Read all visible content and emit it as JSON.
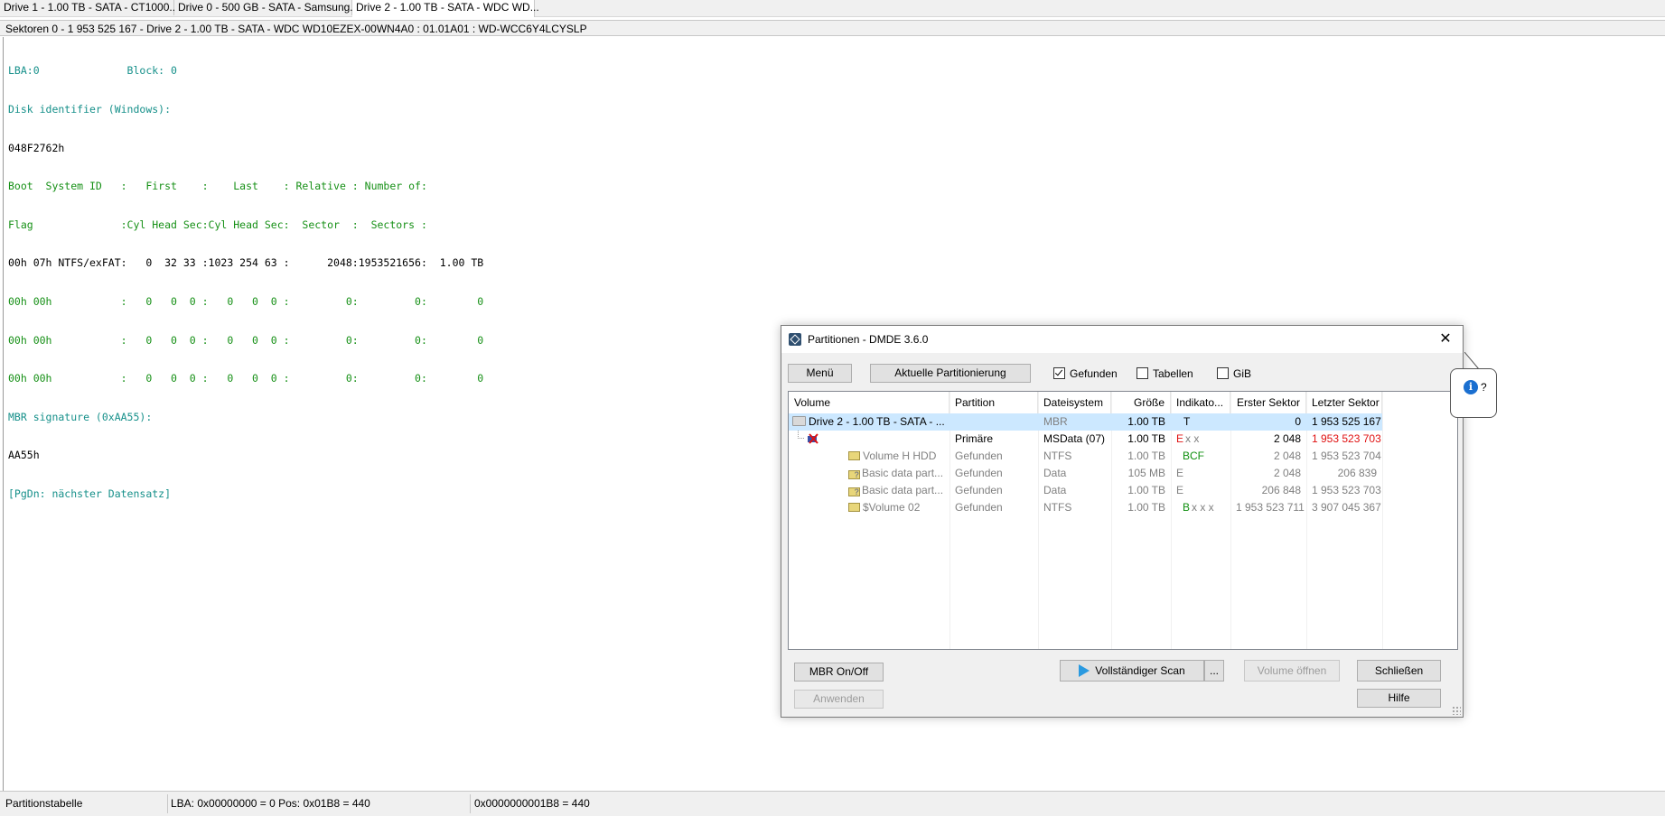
{
  "tabs": [
    {
      "label": "Drive 1 - 1.00 TB - SATA - CT1000..."
    },
    {
      "label": "Drive 0 - 500 GB - SATA - Samsung..."
    },
    {
      "label": "Drive 2 - 1.00 TB - SATA - WDC WD..."
    }
  ],
  "infobar": {
    "text": "Sektoren 0 - 1 953 525 167 - Drive 2 - 1.00 TB - SATA - WDC WD10EZEX-00WN4A0 : 01.01A01 : WD-WCC6Y4LCYSLP"
  },
  "hexview": {
    "lines": [
      "LBA:0              Block: 0",
      "Disk identifier (Windows):",
      "048F2762h",
      "Boot  System ID   :   First    :    Last    : Relative : Number of:",
      "Flag              :Cyl Head Sec:Cyl Head Sec:  Sector  :  Sectors :",
      "00h 07h NTFS/exFAT:   0  32 33 :1023 254 63 :      2048:1953521656:  1.00 TB",
      "00h 00h           :   0   0  0 :   0   0  0 :         0:         0:        0",
      "00h 00h           :   0   0  0 :   0   0  0 :         0:         0:        0",
      "00h 00h           :   0   0  0 :   0   0  0 :         0:         0:        0",
      "MBR signature (0xAA55):",
      "AA55h",
      "[PgDn: nächster Datensatz]"
    ]
  },
  "statusbar": {
    "section": "Partitionstabelle",
    "position": "LBA: 0x00000000 = 0  Pos: 0x01B8 = 440",
    "offset": "0x0000000001B8 = 440"
  },
  "dialog": {
    "title": "Partitionen - DMDE 3.6.0",
    "close": "✕",
    "menu_button": "Menü",
    "current_partitioning_button": "Aktuelle Partitionierung",
    "checkbox_found": "Gefunden",
    "checkbox_tables": "Tabellen",
    "checkbox_gib": "GiB",
    "columns": {
      "volume": "Volume",
      "partition": "Partition",
      "filesystem": "Dateisystem",
      "size": "Größe",
      "indicators": "Indikato...",
      "first_sector": "Erster Sektor",
      "last_sector": "Letzter Sektor"
    },
    "rows": [
      {
        "volume": "Drive 2 - 1.00 TB - SATA - ...",
        "partition": "",
        "filesystem": "MBR",
        "size": "1.00 TB",
        "ind": "T",
        "first": "0",
        "last": "1 953 525 167"
      },
      {
        "volume": "",
        "partition": "Primäre",
        "filesystem": "MSData (07)",
        "size": "1.00 TB",
        "ind_e": "E",
        "ind_rest": "x x",
        "first": "2 048",
        "last": "1 953 523 703"
      },
      {
        "volume": "Volume H HDD",
        "partition": "Gefunden",
        "filesystem": "NTFS",
        "size": "1.00 TB",
        "ind": "BCF",
        "first": "2 048",
        "last": "1 953 523 704"
      },
      {
        "volume": "Basic data part...",
        "partition": "Gefunden",
        "filesystem": "Data",
        "size": "105 MB",
        "ind": "E",
        "first": "2 048",
        "last": "206 839"
      },
      {
        "volume": "Basic data part...",
        "partition": "Gefunden",
        "filesystem": "Data",
        "size": "1.00 TB",
        "ind": "E",
        "first": "206 848",
        "last": "1 953 523 703"
      },
      {
        "volume": "$Volume 02",
        "partition": "Gefunden",
        "filesystem": "NTFS",
        "size": "1.00 TB",
        "ind_b": "B",
        "ind_rest": "x x x",
        "first": "1 953 523 711",
        "last": "3 907 045 367"
      }
    ],
    "mbr_onoff_button": "MBR On/Off",
    "apply_button": "Anwenden",
    "full_scan_button": "Vollständiger Scan",
    "more_button": "...",
    "open_volume_button": "Volume öffnen",
    "close_button": "Schließen",
    "help_button": "Hilfe"
  },
  "tooltip": {
    "text": "?"
  },
  "colors": {
    "accent": "#2a9ae0",
    "selection": "#cce8ff",
    "red": "#e01010",
    "green": "#109010"
  }
}
